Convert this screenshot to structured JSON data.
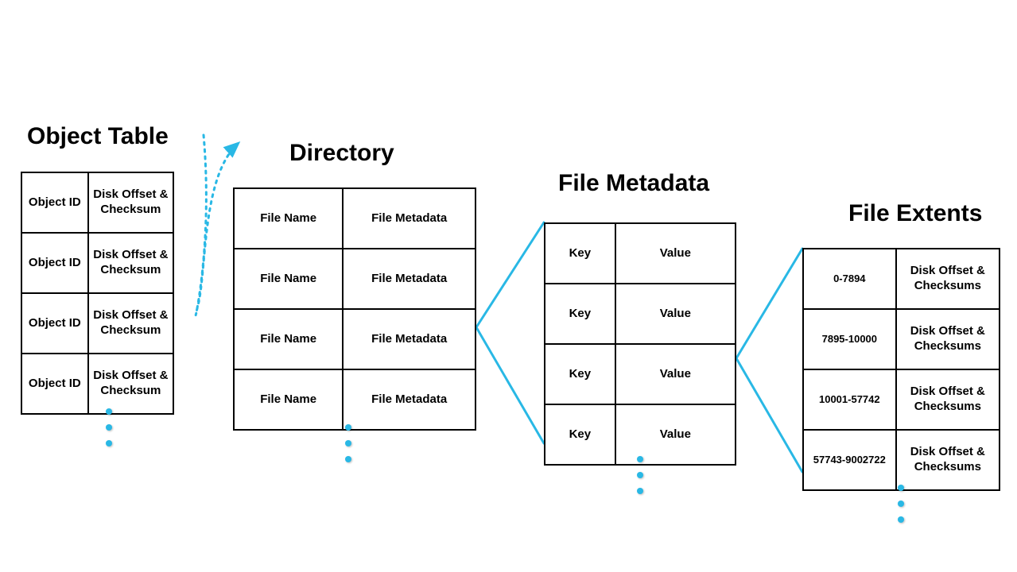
{
  "object_table": {
    "title": "Object Table",
    "rows": [
      {
        "col1": "Object ID",
        "col2": "Disk Offset & Checksum"
      },
      {
        "col1": "Object ID",
        "col2": "Disk Offset & Checksum"
      },
      {
        "col1": "Object ID",
        "col2": "Disk Offset & Checksum"
      },
      {
        "col1": "Object ID",
        "col2": "Disk Offset & Checksum"
      }
    ]
  },
  "directory": {
    "title": "Directory",
    "rows": [
      {
        "col1": "File Name",
        "col2": "File Metadata"
      },
      {
        "col1": "File Name",
        "col2": "File Metadata"
      },
      {
        "col1": "File Name",
        "col2": "File Metadata"
      },
      {
        "col1": "File Name",
        "col2": "File Metadata"
      }
    ]
  },
  "file_metadata": {
    "title": "File Metadata",
    "rows": [
      {
        "col1": "Key",
        "col2": "Value"
      },
      {
        "col1": "Key",
        "col2": "Value"
      },
      {
        "col1": "Key",
        "col2": "Value"
      },
      {
        "col1": "Key",
        "col2": "Value"
      }
    ]
  },
  "file_extents": {
    "title": "File Extents",
    "rows": [
      {
        "col1": "0-7894",
        "col2": "Disk Offset & Checksums"
      },
      {
        "col1": "7895-10000",
        "col2": "Disk Offset & Checksums"
      },
      {
        "col1": "10001-57742",
        "col2": "Disk Offset & Checksums"
      },
      {
        "col1": "57743-9002722",
        "col2": "Disk Offset & Checksums"
      }
    ]
  }
}
